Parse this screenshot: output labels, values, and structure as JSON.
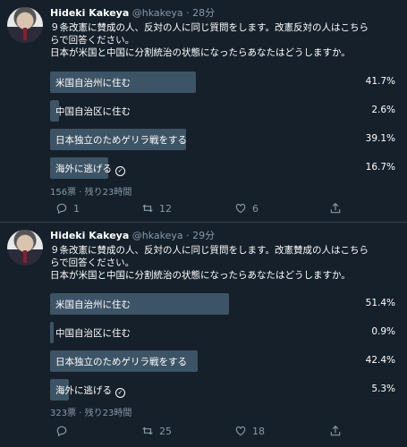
{
  "tweets": [
    {
      "author": {
        "name": "Hideki Kakeya",
        "handle": "@hkakeya",
        "separator": "·",
        "time": "28分"
      },
      "text": [
        "９条改憲に賛成の人、反対の人に同じ質問をします。改憲反対の人はこちら",
        "らで回答ください。",
        "日本が米国と中国に分割統治の状態になったらあなたはどうしますか。"
      ],
      "poll": [
        {
          "label": "米国自治州に住む",
          "percent": "41.7%",
          "fraction": 0.417,
          "selected": false
        },
        {
          "label": "中国自治区に住む",
          "percent": "2.6%",
          "fraction": 0.026,
          "selected": false
        },
        {
          "label": "日本独立のためゲリラ戦をする",
          "percent": "39.1%",
          "fraction": 0.391,
          "selected": false
        },
        {
          "label": "海外に逃げる",
          "percent": "16.7%",
          "fraction": 0.167,
          "selected": true
        }
      ],
      "meta": "156票 · 残り23時間",
      "actions": {
        "reply": "1",
        "retweet": "12",
        "like": "6"
      }
    },
    {
      "author": {
        "name": "Hideki Kakeya",
        "handle": "@hkakeya",
        "separator": "·",
        "time": "29分"
      },
      "text": [
        "９条改憲に賛成の人、反対の人に同じ質問をします。改憲賛成の人はこちら",
        "らで回答ください。",
        "日本が米国と中国に分割統治の状態になったらあなたはどうしますか。"
      ],
      "poll": [
        {
          "label": "米国自治州に住む",
          "percent": "51.4%",
          "fraction": 0.514,
          "selected": false
        },
        {
          "label": "中国自治区に住む",
          "percent": "0.9%",
          "fraction": 0.009,
          "selected": false
        },
        {
          "label": "日本独立のためゲリラ戦をする",
          "percent": "42.4%",
          "fraction": 0.424,
          "selected": false
        },
        {
          "label": "海外に逃げる",
          "percent": "5.3%",
          "fraction": 0.053,
          "selected": true
        }
      ],
      "meta": "323票 · 残り23時間",
      "actions": {
        "reply": "",
        "retweet": "25",
        "like": "18"
      }
    }
  ],
  "icons": {
    "reply": "reply-icon",
    "retweet": "retweet-icon",
    "like": "like-icon",
    "share": "share-icon",
    "check": "check-icon"
  },
  "colors": {
    "background": "#15202b",
    "bar": "#3d5466",
    "muted": "#8899a6"
  }
}
